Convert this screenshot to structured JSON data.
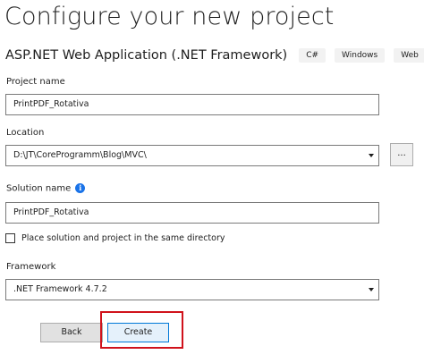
{
  "header": {
    "title": "Configure your new project",
    "subtitle": "ASP.NET Web Application (.NET Framework)",
    "tags": [
      "C#",
      "Windows",
      "Web"
    ]
  },
  "form": {
    "project_name": {
      "label": "Project name",
      "value": "PrintPDF_Rotativa"
    },
    "location": {
      "label": "Location",
      "value": "D:\\JT\\CoreProgramm\\Blog\\MVC\\",
      "browse_label": "..."
    },
    "solution_name": {
      "label": "Solution name",
      "value": "PrintPDF_Rotativa",
      "info_icon": "info-icon"
    },
    "same_directory": {
      "label": "Place solution and project in the same directory",
      "checked": false
    },
    "framework": {
      "label": "Framework",
      "value": ".NET Framework 4.7.2"
    }
  },
  "footer": {
    "back_label": "Back",
    "create_label": "Create"
  },
  "colors": {
    "highlight": "#d0121b",
    "accent": "#0078d7",
    "info": "#1a73e8"
  }
}
